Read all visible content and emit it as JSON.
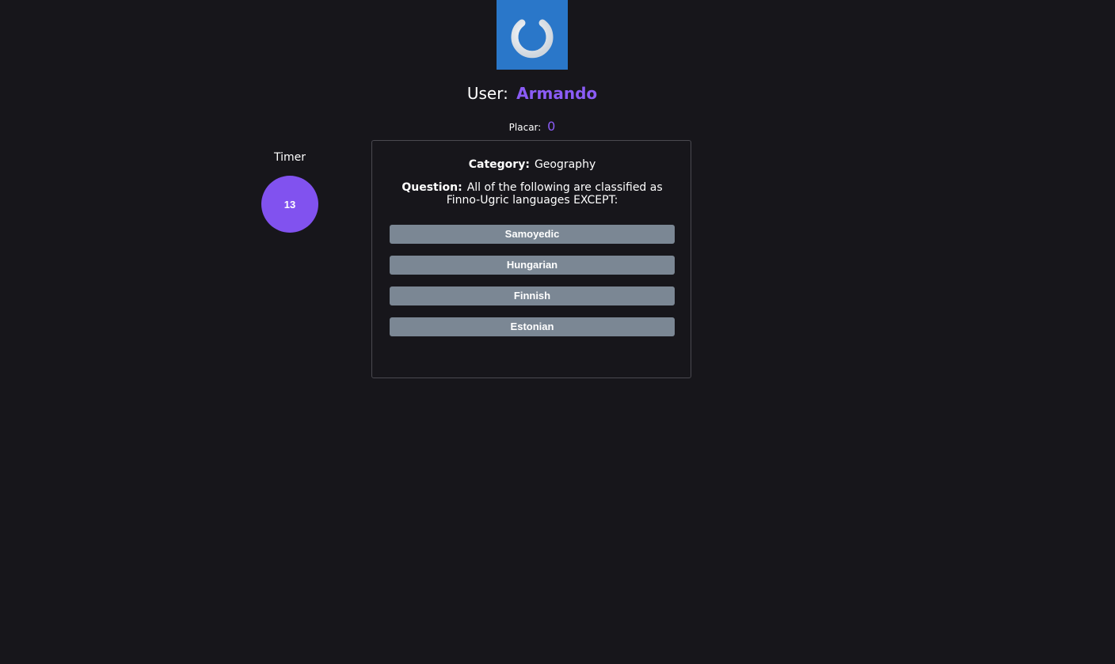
{
  "logo": {
    "icon": "power-icon",
    "bg_color": "#2a77c9"
  },
  "user": {
    "label": "User:",
    "name": "Armando"
  },
  "score": {
    "label": "Placar:",
    "value": "0"
  },
  "timer": {
    "label": "Timer",
    "value": "13"
  },
  "question_card": {
    "category_label": "Category:",
    "category": "Geography",
    "question_label": "Question:",
    "question": "All of the following are classified as Finno-Ugric languages EXCEPT:",
    "answers": [
      "Samoyedic",
      "Hungarian",
      "Finnish",
      "Estonian"
    ]
  },
  "colors": {
    "accent": "#8b5cf6",
    "background": "#17161b",
    "answer_bg": "#7b8794"
  }
}
